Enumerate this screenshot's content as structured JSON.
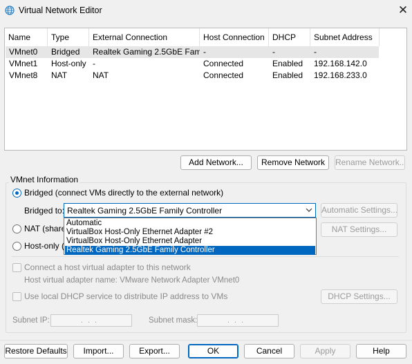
{
  "window": {
    "title": "Virtual Network Editor",
    "icon": "globe-network-icon",
    "close_icon": "close-icon"
  },
  "table": {
    "columns": [
      "Name",
      "Type",
      "External Connection",
      "Host Connection",
      "DHCP",
      "Subnet Address"
    ],
    "rows": [
      [
        "VMnet0",
        "Bridged",
        "Realtek Gaming 2.5GbE Fam...",
        "-",
        "-",
        "-"
      ],
      [
        "VMnet1",
        "Host-only",
        "-",
        "Connected",
        "Enabled",
        "192.168.142.0"
      ],
      [
        "VMnet8",
        "NAT",
        "NAT",
        "Connected",
        "Enabled",
        "192.168.233.0"
      ]
    ],
    "selected_row": 0
  },
  "table_buttons": {
    "add_network": "Add Network...",
    "remove_network": "Remove Network",
    "rename_network": "Rename Network..."
  },
  "vmnet_info": {
    "group_label": "VMnet Information",
    "bridged_label": "Bridged (connect VMs directly to the external network)",
    "bridged_to_label": "Bridged to:",
    "bridged_to_value": "Realtek Gaming 2.5GbE Family Controller",
    "automatic_settings": "Automatic Settings...",
    "nat_label": "NAT (shared",
    "nat_settings": "NAT Settings...",
    "host_only_label": "Host-only (c",
    "dropdown_options": [
      "Automatic",
      "VirtualBox Host-Only Ethernet Adapter #2",
      "VirtualBox Host-Only Ethernet Adapter",
      "Realtek Gaming 2.5GbE Family Controller"
    ],
    "dropdown_highlighted": 3,
    "connect_host_adapter": "Connect a host virtual adapter to this network",
    "host_adapter_name": "Host virtual adapter name: VMware Network Adapter VMnet0",
    "use_dhcp": "Use local DHCP service to distribute IP address to VMs",
    "dhcp_settings": "DHCP Settings...",
    "subnet_ip_label": "Subnet IP:",
    "subnet_ip_value": "...",
    "subnet_mask_label": "Subnet mask:",
    "subnet_mask_value": "..."
  },
  "footer": {
    "restore_defaults": "Restore Defaults",
    "import": "Import...",
    "export": "Export...",
    "ok": "OK",
    "cancel": "Cancel",
    "apply": "Apply",
    "help": "Help"
  },
  "colors": {
    "accent": "#0067c0",
    "selection": "#e6e6e6"
  }
}
